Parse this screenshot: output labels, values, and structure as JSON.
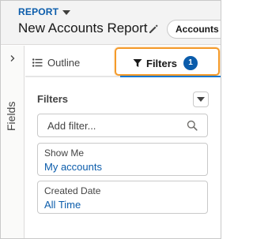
{
  "header": {
    "eyebrow": "REPORT",
    "title": "New Accounts Report",
    "chip_label": "Accounts"
  },
  "rail": {
    "label": "Fields"
  },
  "tabs": {
    "outline_label": "Outline",
    "filters_label": "Filters",
    "filters_count": "1"
  },
  "panel": {
    "title": "Filters",
    "search": {
      "placeholder": "Add filter...",
      "value": ""
    },
    "filters": [
      {
        "label": "Show Me",
        "value": "My accounts"
      },
      {
        "label": "Created Date",
        "value": "All Time"
      }
    ]
  },
  "colors": {
    "accent": "#0b5cab",
    "highlight": "#f49a2a",
    "active_tab_underline": "#0176d3"
  },
  "icons": {
    "eyebrow_caret": "caret-down-icon",
    "title_edit": "pencil-icon",
    "rail_toggle": "chevron-right-icon",
    "outline_tab": "list-icon",
    "filters_tab": "funnel-icon",
    "panel_menu": "caret-down-icon",
    "search": "search-icon"
  }
}
